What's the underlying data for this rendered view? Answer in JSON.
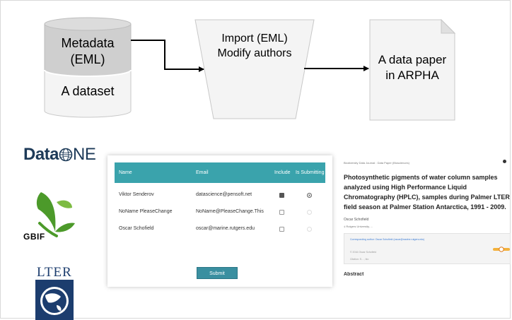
{
  "diagram": {
    "cylinder_top_label": "Metadata\n(EML)",
    "cylinder_bottom_label": "A dataset",
    "trapezoid_label": "Import (EML)\nModify authors",
    "document_label": "A data paper\nin ARPHA"
  },
  "logos": {
    "dataone_data": "Data",
    "dataone_one": "NE",
    "gbif": "GBIF",
    "lter": "LTER"
  },
  "form": {
    "headers": {
      "name": "Name",
      "email": "Email",
      "include": "Include",
      "submitting": "Is Submitting"
    },
    "rows": [
      {
        "name": "Viktor Senderov",
        "email": "datascience@pensoft.net",
        "include": true,
        "submitting": true
      },
      {
        "name": "NoName PleaseChange",
        "email": "NoName@PleaseChange.This",
        "include": false,
        "submitting": false
      },
      {
        "name": "Oscar Schofield",
        "email": "oscar@marine.rutgers.edu",
        "include": false,
        "submitting": false
      }
    ],
    "submit_label": "Submit"
  },
  "paper": {
    "journal_line": "Biodiversity Data Journal : Data Paper (Biosciences)",
    "title": "Photosynthetic pigments of water column samples analyzed using High Performance Liquid Chromatography (HPLC), samples during Palmer LTER field season at Palmer Station Antarctica, 1991 - 2009.",
    "author": "Oscar Schofield",
    "affiliation": "‡ Rutgers University, ...",
    "corresponding": "Corresponding author: Oscar Schofield (oscar@marine.rutgers.edu)",
    "copyright": "© 2016 Oscar Schofield",
    "citation": "Citation: S…, bio",
    "abstract_heading": "Abstract"
  },
  "colors": {
    "table_header": "#3aa3ac",
    "submit": "#3a8fa0",
    "cylinder_top": "#cccccc",
    "cylinder_body": "#f4f4f4"
  }
}
